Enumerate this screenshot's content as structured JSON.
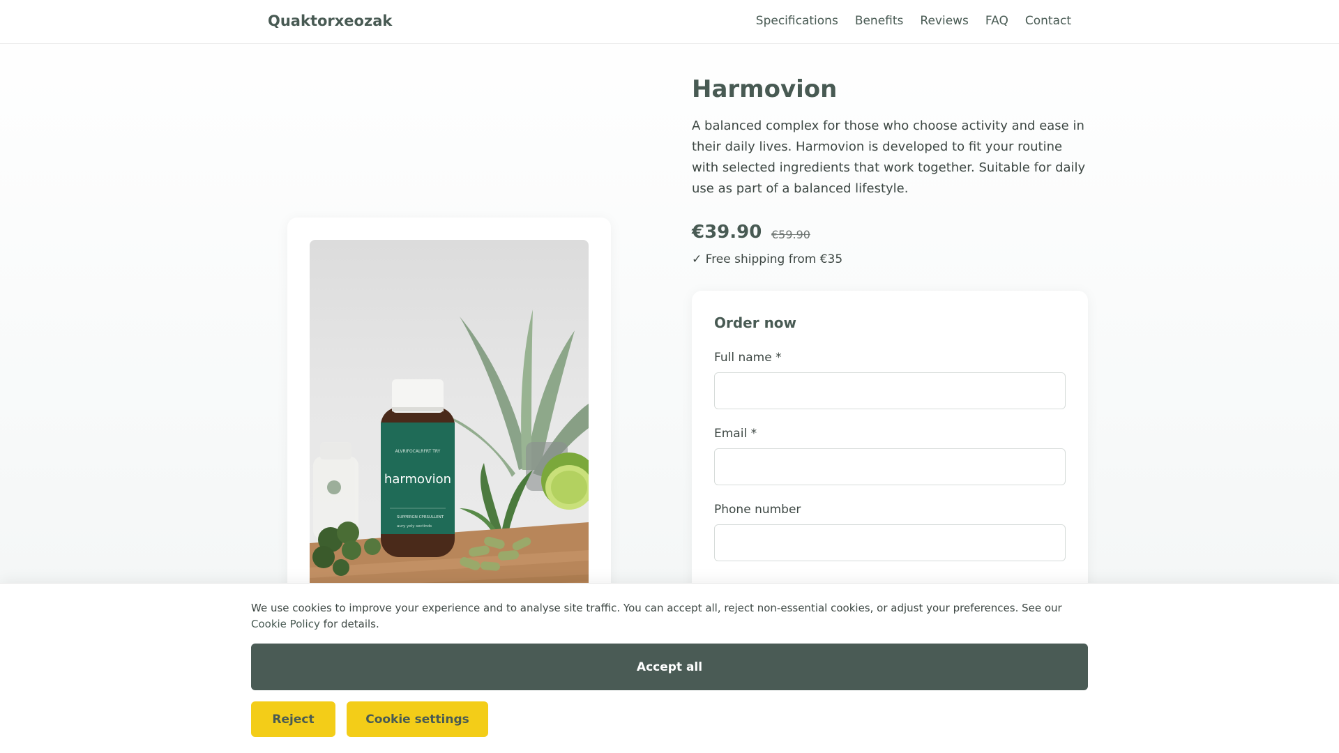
{
  "header": {
    "brand": "Quaktorxeozak",
    "nav": [
      "Specifications",
      "Benefits",
      "Reviews",
      "FAQ",
      "Contact"
    ]
  },
  "product": {
    "title": "Harmovion",
    "description": "A balanced complex for those who choose activity and ease in their daily lives. Harmovion is developed to fit your routine with selected ingredients that work together. Suitable for daily use as part of a balanced lifestyle.",
    "price": "€39.90",
    "old_price": "€59.90",
    "shipping": "✓ Free shipping from €35",
    "image_label": "harmovion",
    "image_small_text_top": "ALVRIFOCALRFRT TRY",
    "image_small_text_bottom": "SUPPERGN CPRSULLENT",
    "image_small_text_bottom2": "aury yoly sectinds"
  },
  "order_form": {
    "title": "Order now",
    "fields": [
      {
        "label": "Full name *",
        "value": ""
      },
      {
        "label": "Email *",
        "value": ""
      },
      {
        "label": "Phone number",
        "value": ""
      }
    ]
  },
  "cookie_banner": {
    "text": "We use cookies to improve your experience and to analyse site traffic. You can accept all, reject non-essential cookies, or adjust your preferences. See our",
    "link_text": "Cookie Policy",
    "text_after": "for details.",
    "accept_label": "Accept all",
    "reject_label": "Reject",
    "settings_label": "Cookie settings"
  },
  "colors": {
    "brand": "#485a53",
    "accept_bg": "#4a5b55",
    "yellow": "#f3cd18",
    "bottle_label": "#1f6b57"
  }
}
